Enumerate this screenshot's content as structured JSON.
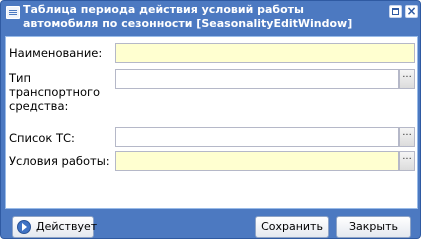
{
  "window": {
    "title": "Таблица периода действия условий работы автомобиля по сезонности [SeasonalityEditWindow]"
  },
  "form": {
    "fields": [
      {
        "label": "Наименование:",
        "value": ""
      },
      {
        "label": "Тип транспортного средства:",
        "value": "",
        "trigger_glyph": "···"
      },
      {
        "label": "Список ТС:",
        "value": "",
        "trigger_glyph": "···"
      },
      {
        "label": "Условия работы:",
        "value": "",
        "trigger_glyph": "···"
      }
    ]
  },
  "footer": {
    "status_label": "Действует",
    "save_label": "Сохранить",
    "close_label": "Закрыть"
  },
  "colors": {
    "window_frame": "#4c79c1",
    "required_field_bg": "#ffffd0",
    "panel_border": "#99bbe8"
  }
}
